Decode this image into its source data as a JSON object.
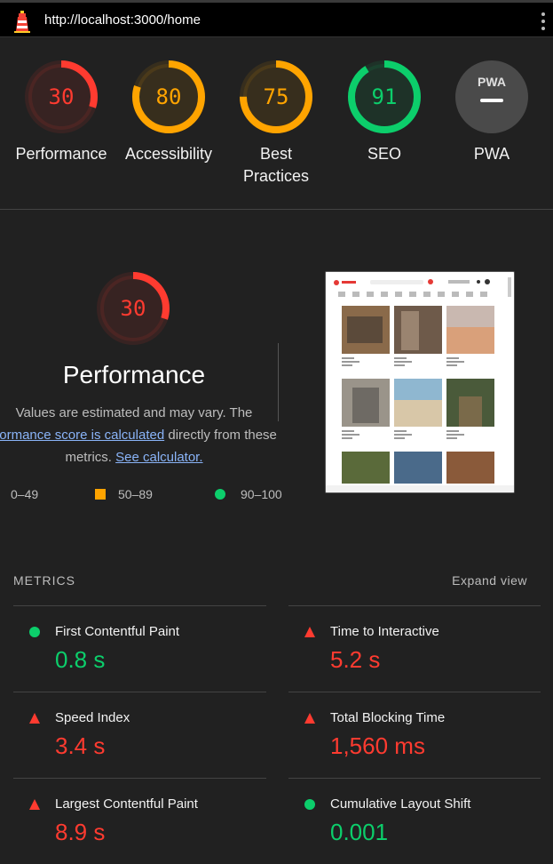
{
  "topbar": {
    "url": "http://localhost:3000/home",
    "logo_icon": "lighthouse-icon",
    "menu_icon": "kebab-menu-icon"
  },
  "colors": {
    "fail": "#ff3b30",
    "average": "#ffa400",
    "pass": "#0cce6b",
    "na": "#9e9e9e"
  },
  "categories": [
    {
      "score": "30",
      "label": "Performance",
      "status": "fail",
      "fraction": 0.3
    },
    {
      "score": "80",
      "label": "Accessibility",
      "status": "average",
      "fraction": 0.8
    },
    {
      "score": "75",
      "label": "Best Practices",
      "status": "average",
      "fraction": 0.75
    },
    {
      "score": "91",
      "label": "SEO",
      "status": "pass",
      "fraction": 0.91
    },
    {
      "score": "",
      "label": "PWA",
      "status": "na",
      "badge": "PWA"
    }
  ],
  "main": {
    "score": "30",
    "fraction": 0.3,
    "title": "Performance",
    "desc_line1": "Values are estimated and may vary. The",
    "desc_link1": "rformance score is calculated",
    "desc_line2_rest": " directly from these",
    "desc_line3": "metrics.",
    "desc_link2": "See calculator."
  },
  "legend": [
    {
      "label": "0–49",
      "shape": "triangle"
    },
    {
      "label": "50–89",
      "shape": "square"
    },
    {
      "label": "90–100",
      "shape": "circle"
    }
  ],
  "metrics_header": {
    "title": "METRICS",
    "expand": "Expand view"
  },
  "metrics": [
    {
      "name": "First Contentful Paint",
      "value": "0.8 s",
      "status": "pass"
    },
    {
      "name": "Time to Interactive",
      "value": "5.2 s",
      "status": "fail"
    },
    {
      "name": "Speed Index",
      "value": "3.4 s",
      "status": "fail"
    },
    {
      "name": "Total Blocking Time",
      "value": "1,560 ms",
      "status": "fail"
    },
    {
      "name": "Largest Contentful Paint",
      "value": "8.9 s",
      "status": "fail"
    },
    {
      "name": "Cumulative Layout Shift",
      "value": "0.001",
      "status": "pass"
    }
  ]
}
